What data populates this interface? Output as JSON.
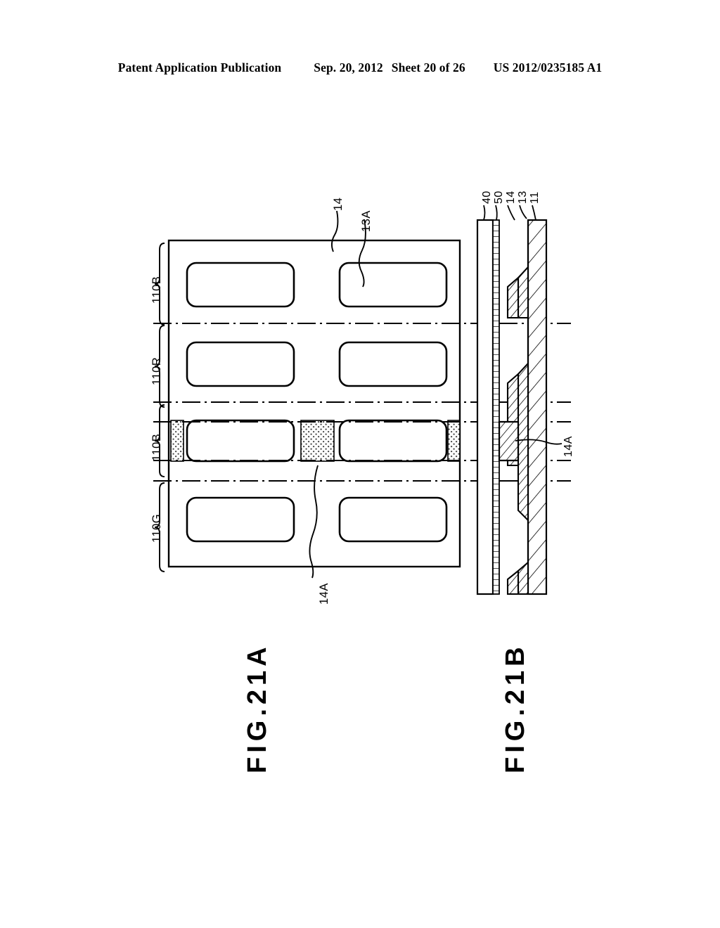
{
  "header": {
    "publication": "Patent Application Publication",
    "date": "Sep. 20, 2012",
    "sheet": "Sheet 20 of 26",
    "docnum": "US 2012/0235185 A1"
  },
  "figures": [
    {
      "id": "fig-21a",
      "caption": "FIG.21A"
    },
    {
      "id": "fig-21b",
      "caption": "FIG.21B"
    }
  ],
  "fig21a": {
    "row_labels": [
      "110B",
      "110R",
      "110B",
      "110G"
    ],
    "callouts": [
      {
        "id": "callout-14",
        "text": "14"
      },
      {
        "id": "callout-13a",
        "text": "13A"
      },
      {
        "id": "callout-14a",
        "text": "14A"
      }
    ]
  },
  "fig21b": {
    "layer_labels": [
      "40",
      "50",
      "14",
      "13",
      "11"
    ],
    "callouts": [
      {
        "id": "callout-14a-b",
        "text": "14A"
      }
    ]
  },
  "colors": {
    "ink": "#000000",
    "paper": "#ffffff",
    "stipple": "#555555"
  }
}
